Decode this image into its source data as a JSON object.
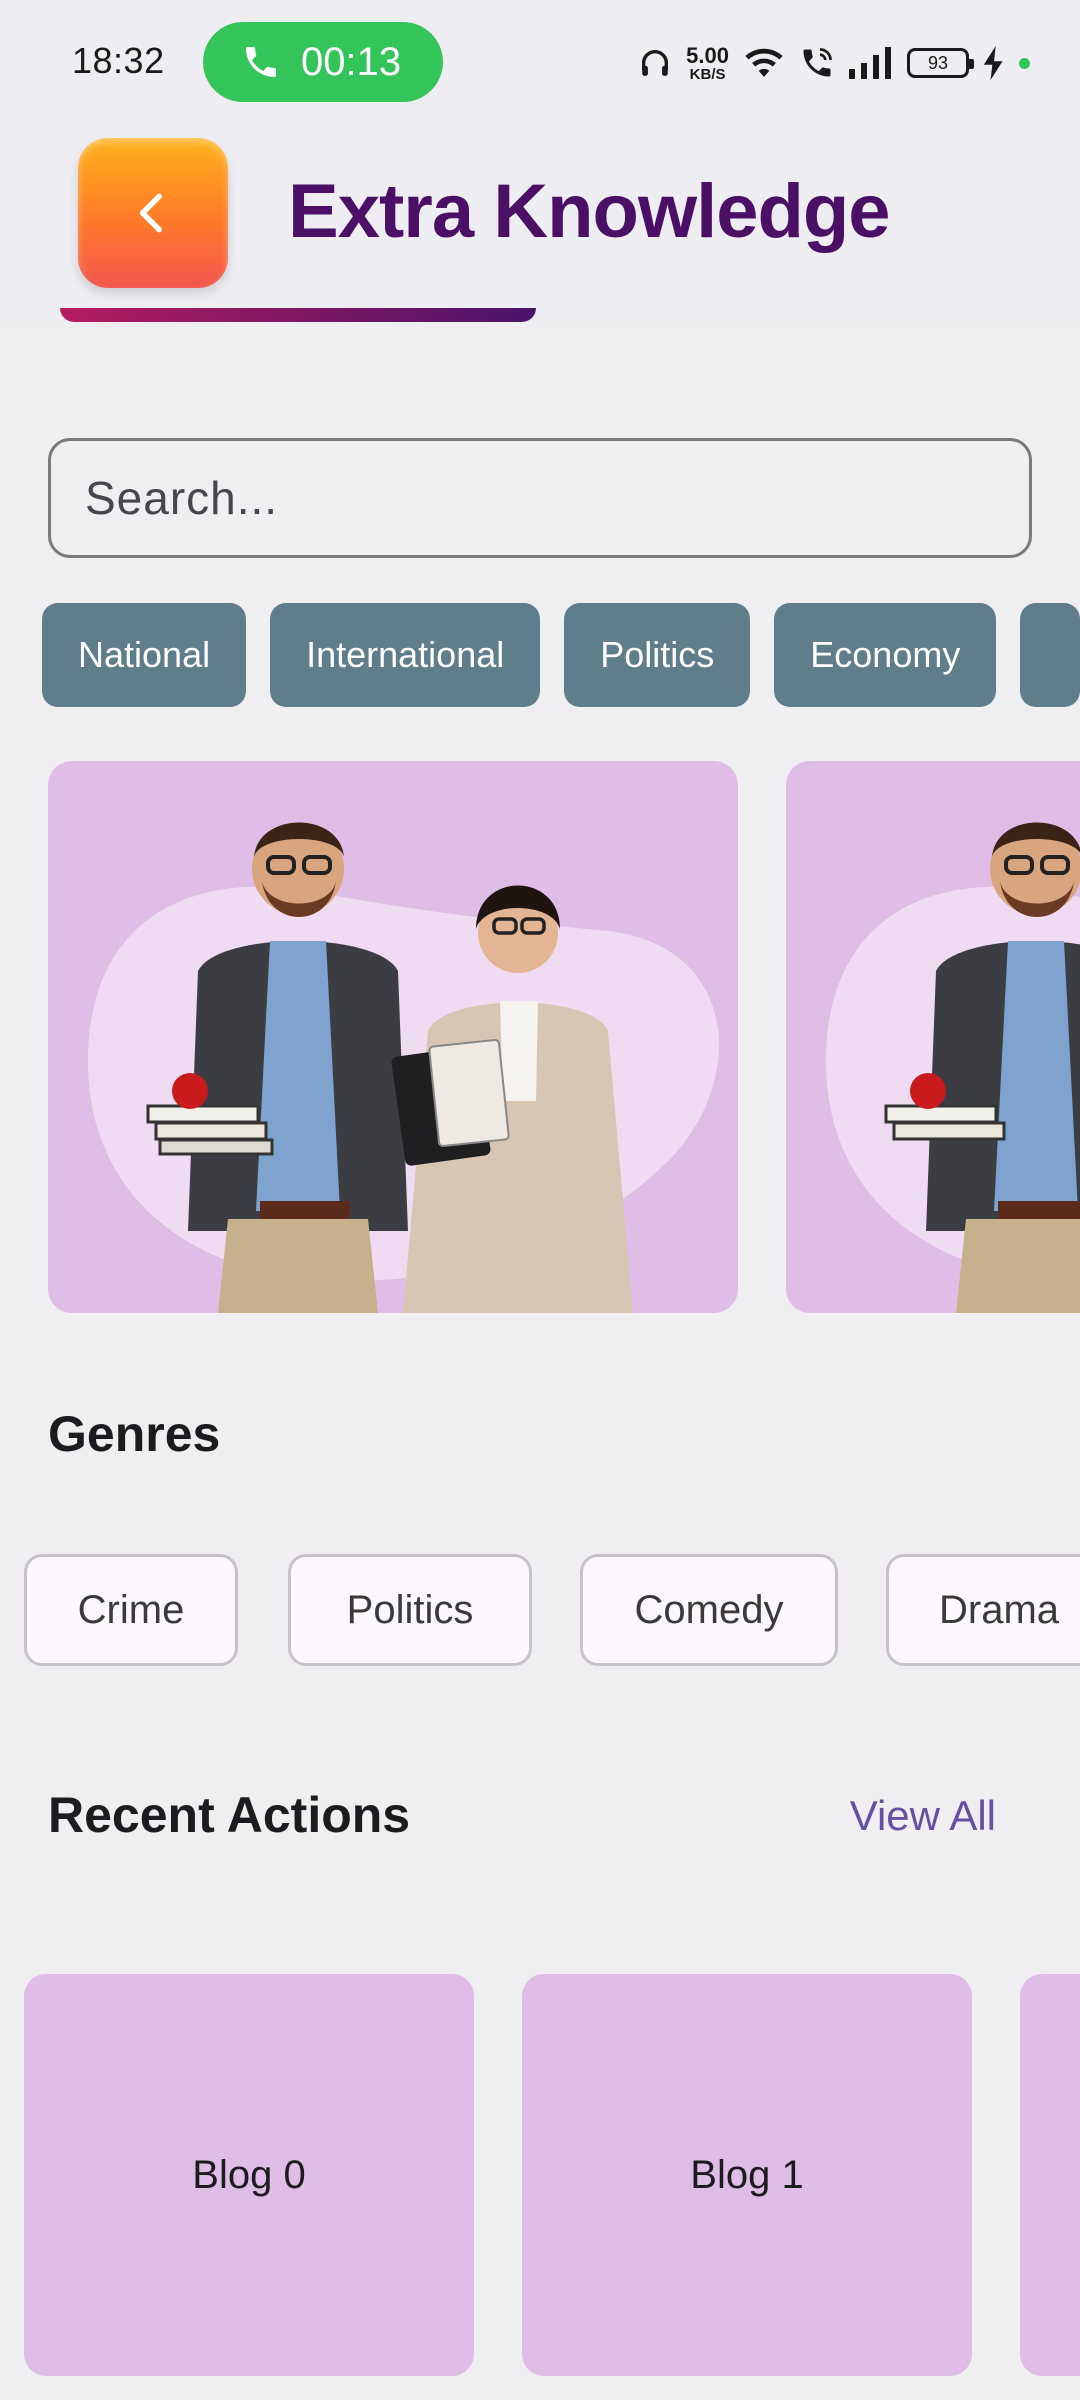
{
  "status_bar": {
    "time": "18:32",
    "call_duration": "00:13",
    "net_speed_value": "5.00",
    "net_speed_unit": "KB/S",
    "battery": "93",
    "colors": {
      "call_pill": "#33c45a",
      "dot": "#30c75a"
    }
  },
  "header": {
    "title": "Extra Knowledge",
    "colors": {
      "title": "#4b0f66",
      "back_gradient_top": "#ffb21a",
      "back_gradient_bottom": "#f2574e"
    }
  },
  "search": {
    "placeholder": "Search..."
  },
  "categories": [
    "National",
    "International",
    "Politics",
    "Economy"
  ],
  "carousel": {
    "slide_count_visible": 2
  },
  "genres": {
    "title": "Genres",
    "items": [
      "Crime",
      "Politics",
      "Comedy",
      "Drama"
    ]
  },
  "recent_actions": {
    "title": "Recent Actions",
    "view_all": "View All",
    "blogs": [
      "Blog 0",
      "Blog 1"
    ]
  },
  "colors": {
    "chip_bg": "#607d8b",
    "card_bg": "#e0bde6",
    "accent": "#6750a4",
    "background": "#efeef0"
  }
}
